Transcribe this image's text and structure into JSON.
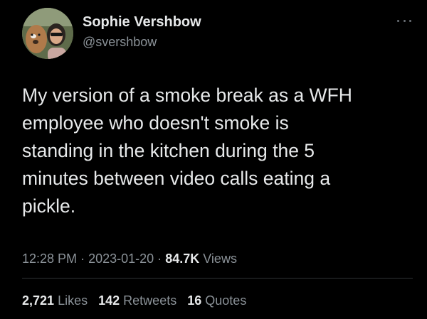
{
  "author": {
    "name": "Sophie Vershbow",
    "handle": "@svershbow"
  },
  "tweet": {
    "lines": [
      "My version of a smoke break as a WFH",
      "employee who doesn't smoke is",
      "standing in the kitchen during the 5",
      "minutes between video calls eating a",
      "pickle."
    ]
  },
  "meta": {
    "time": "12:28 PM",
    "separator": "·",
    "date": "2023-01-20",
    "views_count": "84.7K",
    "views_label": "Views"
  },
  "stats": {
    "likes_count": "2,721",
    "likes_label": "Likes",
    "retweets_count": "142",
    "retweets_label": "Retweets",
    "quotes_count": "16",
    "quotes_label": "Quotes"
  },
  "colors": {
    "background": "#000000",
    "primary_text": "#e7e9ea",
    "secondary_text": "#8b9298",
    "divider": "#2f3336"
  },
  "icons": {
    "more": "more-dots-icon"
  }
}
